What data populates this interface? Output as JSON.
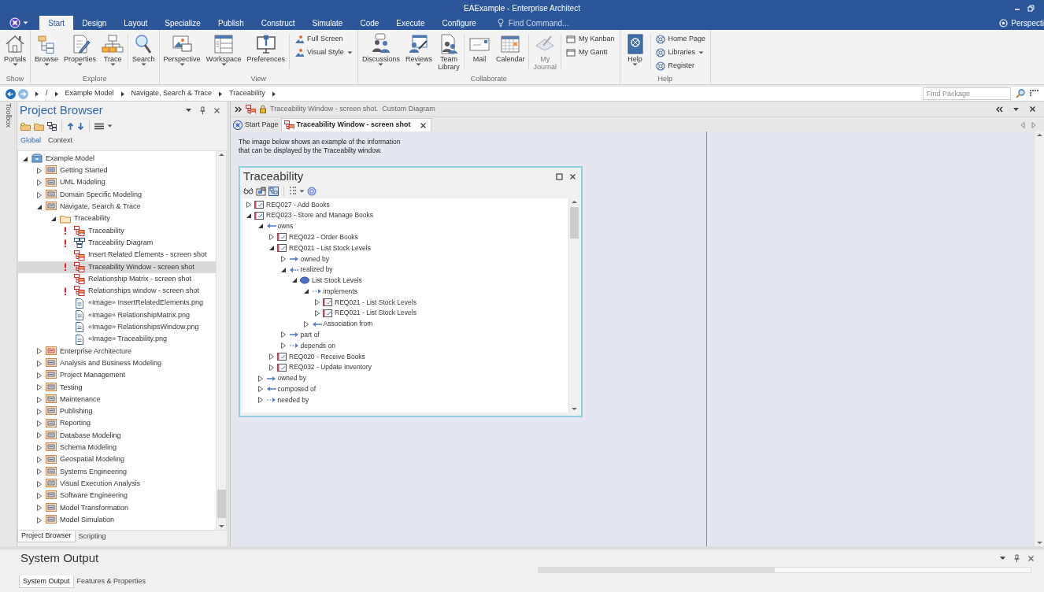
{
  "window": {
    "title": "EAExample - Enterprise Architect"
  },
  "ribbon_tabs": [
    {
      "label": "Start",
      "selected": true
    },
    {
      "label": "Design",
      "selected": false
    },
    {
      "label": "Layout",
      "selected": false
    },
    {
      "label": "Specialize",
      "selected": false
    },
    {
      "label": "Publish",
      "selected": false
    },
    {
      "label": "Construct",
      "selected": false
    },
    {
      "label": "Simulate",
      "selected": false
    },
    {
      "label": "Code",
      "selected": false
    },
    {
      "label": "Execute",
      "selected": false
    },
    {
      "label": "Configure",
      "selected": false
    }
  ],
  "find_command": {
    "placeholder": "Find Command..."
  },
  "perspective": {
    "label": "Perspecti"
  },
  "ribbon_groups": [
    {
      "label": "Show",
      "buttons": [
        {
          "label": "Portals",
          "dropdown": true,
          "disabled": false
        }
      ]
    },
    {
      "label": "Explore",
      "buttons": [
        {
          "label": "Browse",
          "dropdown": true,
          "disabled": false
        },
        {
          "label": "Properties",
          "dropdown": true,
          "disabled": false
        },
        {
          "label": "Trace",
          "dropdown": true,
          "disabled": false
        },
        {
          "label": "Search",
          "dropdown": true,
          "disabled": false
        }
      ]
    },
    {
      "label": "View",
      "buttons": [
        {
          "label": "Perspective",
          "dropdown": true,
          "disabled": false
        },
        {
          "label": "Workspace",
          "dropdown": true,
          "disabled": false
        },
        {
          "label": "Preferences",
          "dropdown": false,
          "disabled": false
        }
      ],
      "small_buttons": [
        {
          "label": "Full Screen",
          "dropdown": false
        },
        {
          "label": "Visual Style",
          "dropdown": true
        }
      ]
    },
    {
      "label": "Collaborate",
      "buttons": [
        {
          "label": "Discussions",
          "dropdown": true,
          "disabled": false
        },
        {
          "label": "Reviews",
          "dropdown": true,
          "disabled": false
        },
        {
          "label": "Team\nLibrary",
          "dropdown": false,
          "disabled": false
        },
        {
          "label": "Mail",
          "dropdown": false,
          "disabled": false
        },
        {
          "label": "Calendar",
          "dropdown": false,
          "disabled": false
        },
        {
          "label": "My\nJournal",
          "dropdown": false,
          "disabled": true
        }
      ],
      "small_buttons": [
        {
          "label": "My Kanban",
          "dropdown": false
        },
        {
          "label": "My Gantt",
          "dropdown": false
        }
      ]
    },
    {
      "label": "Help",
      "buttons": [
        {
          "label": "Help",
          "dropdown": true,
          "disabled": false
        }
      ],
      "small_buttons": [
        {
          "label": "Home Page",
          "dropdown": false
        },
        {
          "label": "Libraries",
          "dropdown": true
        },
        {
          "label": "Register",
          "dropdown": false
        }
      ]
    }
  ],
  "breadcrumb": {
    "items": [
      "/",
      "Example Model",
      "Navigate, Search & Trace",
      "Traceability"
    ],
    "find_package": {
      "placeholder": "Find Package"
    }
  },
  "project_browser": {
    "title": "Project Browser",
    "side_tab": "Toolbox",
    "view_tabs": [
      {
        "label": "Global",
        "selected": true
      },
      {
        "label": "Context",
        "selected": false
      }
    ],
    "tree": [
      {
        "label": "Example Model",
        "kind": "model",
        "expanded": true,
        "selected": false,
        "children": [
          {
            "label": "Getting Started",
            "kind": "package_usecase",
            "expanded": false,
            "selected": false
          },
          {
            "label": "UML Modeling",
            "kind": "package",
            "expanded": false,
            "selected": false
          },
          {
            "label": "Domain Specific Modeling",
            "kind": "package",
            "expanded": false,
            "selected": false
          },
          {
            "label": "Navigate, Search & Trace",
            "kind": "package",
            "expanded": true,
            "selected": false,
            "children": [
              {
                "label": "Traceability",
                "kind": "folder",
                "expanded": true,
                "selected": false,
                "children": [
                  {
                    "label": "Traceability",
                    "kind": "diagram",
                    "flagged": true,
                    "selected": false
                  },
                  {
                    "label": "Traceability Diagram",
                    "kind": "diagram_custom",
                    "flagged": true,
                    "selected": false
                  },
                  {
                    "label": "Insert Related Elements - screen shot",
                    "kind": "diagram",
                    "flagged": false,
                    "selected": false
                  },
                  {
                    "label": "Traceability Window - screen shot",
                    "kind": "diagram",
                    "flagged": true,
                    "selected": true
                  },
                  {
                    "label": "Relationship Matrix - screen shot",
                    "kind": "diagram",
                    "flagged": false,
                    "selected": false
                  },
                  {
                    "label": "Relationships window - screen shot",
                    "kind": "diagram",
                    "flagged": true,
                    "selected": false
                  },
                  {
                    "label": "«Image» InsertRelatedElements.png",
                    "kind": "image",
                    "flagged": false,
                    "selected": false
                  },
                  {
                    "label": "«Image» RelationshipMatrix.png",
                    "kind": "image",
                    "flagged": false,
                    "selected": false
                  },
                  {
                    "label": "«Image» RelationshipsWindow.png",
                    "kind": "image",
                    "flagged": false,
                    "selected": false
                  },
                  {
                    "label": "«Image» Traceability.png",
                    "kind": "image",
                    "flagged": false,
                    "selected": false
                  }
                ]
              }
            ]
          },
          {
            "label": "Enterprise Architecture",
            "kind": "package_ea",
            "expanded": false,
            "selected": false
          },
          {
            "label": "Analysis and Business Modeling",
            "kind": "package",
            "expanded": false,
            "selected": false
          },
          {
            "label": "Project Management",
            "kind": "package",
            "expanded": false,
            "selected": false
          },
          {
            "label": "Testing",
            "kind": "package",
            "expanded": false,
            "selected": false
          },
          {
            "label": "Maintenance",
            "kind": "package",
            "expanded": false,
            "selected": false
          },
          {
            "label": "Publishing",
            "kind": "package",
            "expanded": false,
            "selected": false
          },
          {
            "label": "Reporting",
            "kind": "package",
            "expanded": false,
            "selected": false
          },
          {
            "label": "Database Modeling",
            "kind": "package",
            "expanded": false,
            "selected": false
          },
          {
            "label": "Schema Modeling",
            "kind": "package",
            "expanded": false,
            "selected": false
          },
          {
            "label": "Geospatial Modeling",
            "kind": "package",
            "expanded": false,
            "selected": false
          },
          {
            "label": "Systems Engineering",
            "kind": "package",
            "expanded": false,
            "selected": false
          },
          {
            "label": "Visual Execution Analysis",
            "kind": "package",
            "expanded": false,
            "selected": false
          },
          {
            "label": "Software Engineering",
            "kind": "package",
            "expanded": false,
            "selected": false
          },
          {
            "label": "Model Transformation",
            "kind": "package",
            "expanded": false,
            "selected": false
          },
          {
            "label": "Model Simulation",
            "kind": "package",
            "expanded": false,
            "selected": false
          }
        ]
      }
    ],
    "bottom_tabs": [
      {
        "label": "Project Browser",
        "selected": true
      },
      {
        "label": "Scripting",
        "selected": false
      }
    ]
  },
  "document": {
    "header": {
      "title": "Traceability Window - screen shot.",
      "subtitle": "Custom Diagram"
    },
    "tabs": [
      {
        "label": "Start Page",
        "kind": "start",
        "selected": false
      },
      {
        "label": "Traceability Window - screen shot",
        "kind": "diagram",
        "selected": true
      }
    ],
    "note": "The image below shows an example of the information\nthat can be displayed by the Traceabilty window.",
    "trace_window": {
      "title": "Traceability",
      "tree": [
        {
          "label": "REQ027 - Add Books",
          "kind": "requirement",
          "expanded": false
        },
        {
          "label": "REQ023 - Store and Manage Books",
          "kind": "requirement",
          "expanded": true,
          "children": [
            {
              "label": "owns",
              "kind": "link_in",
              "expanded": true,
              "children": [
                {
                  "label": "REQ022 - Order Books",
                  "kind": "requirement",
                  "expanded": false
                },
                {
                  "label": "REQ021 - List Stock Levels",
                  "kind": "requirement",
                  "expanded": true,
                  "children": [
                    {
                      "label": "owned by",
                      "kind": "link_out",
                      "expanded": false
                    },
                    {
                      "label": "realized by",
                      "kind": "realize_in",
                      "expanded": true,
                      "children": [
                        {
                          "label": "List Stock Levels",
                          "kind": "usecase",
                          "expanded": true,
                          "children": [
                            {
                              "label": "implements",
                              "kind": "dep_out",
                              "expanded": true,
                              "children": [
                                {
                                  "label": "REQ021 - List Stock Levels",
                                  "kind": "requirement",
                                  "expanded": false
                                },
                                {
                                  "label": "REQ021 - List Stock Levels",
                                  "kind": "requirement",
                                  "expanded": false
                                }
                              ]
                            },
                            {
                              "label": "Association from",
                              "kind": "link_in",
                              "expanded": false
                            }
                          ]
                        }
                      ]
                    },
                    {
                      "label": "part of",
                      "kind": "link_out",
                      "expanded": false
                    },
                    {
                      "label": "depends on",
                      "kind": "dep_out",
                      "expanded": false
                    }
                  ]
                },
                {
                  "label": "REQ020 - Receive Books",
                  "kind": "requirement",
                  "expanded": false
                },
                {
                  "label": "REQ032 - Update Inventory",
                  "kind": "requirement",
                  "expanded": false
                }
              ]
            },
            {
              "label": "owned by",
              "kind": "link_out",
              "expanded": false
            },
            {
              "label": "composed of",
              "kind": "link_in",
              "expanded": false
            },
            {
              "label": "needed by",
              "kind": "dep_out",
              "expanded": false
            }
          ]
        }
      ]
    }
  },
  "system_output": {
    "title": "System Output",
    "tabs": [
      {
        "label": "System Output",
        "selected": true
      },
      {
        "label": "Features & Properties",
        "selected": false
      }
    ]
  }
}
